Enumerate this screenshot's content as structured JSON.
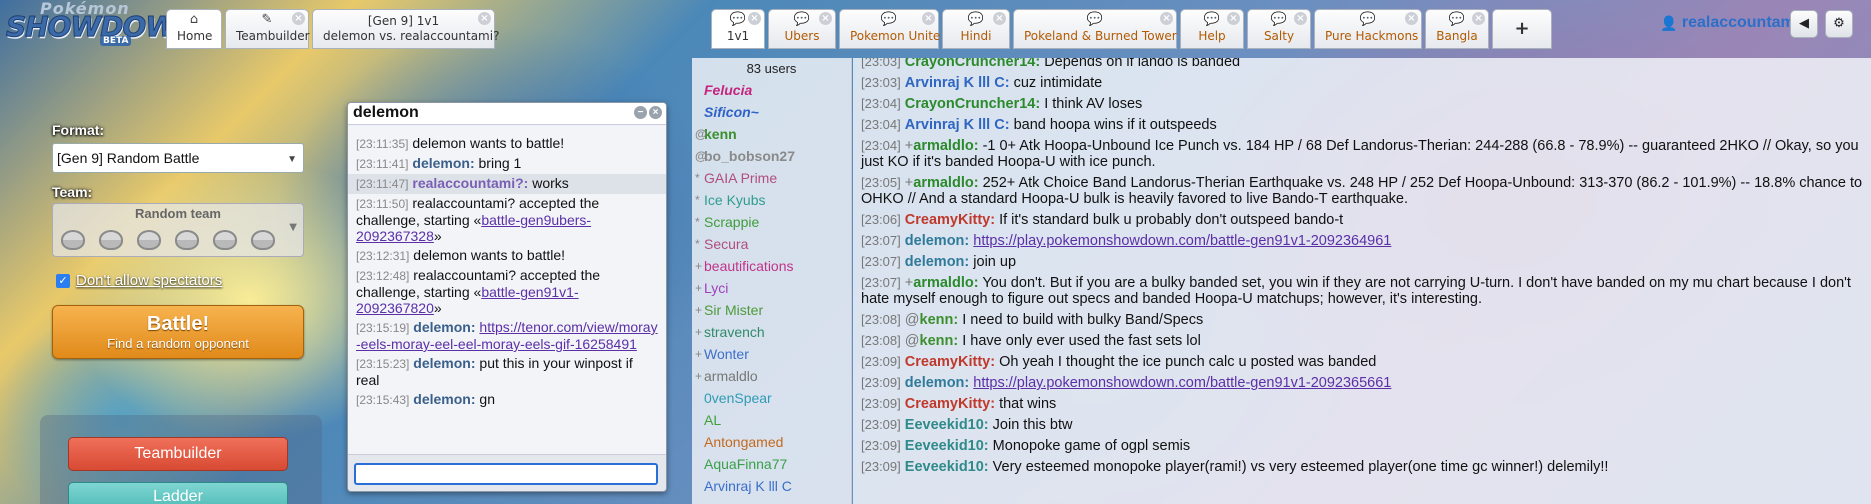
{
  "logo": {
    "line1": "Pokémon",
    "line2": "SHOWDOWN",
    "badge": "BETA"
  },
  "tabs": {
    "home": {
      "icon": "home-icon",
      "label": "Home"
    },
    "teambuilder": {
      "icon": "pencil-icon",
      "label": "Teambuilder"
    },
    "battle": {
      "line1": "[Gen 9] 1v1",
      "line2": "delemon vs. realaccountami?"
    },
    "rooms": [
      {
        "label": "1v1",
        "active": true
      },
      {
        "label": "Ubers"
      },
      {
        "label": "Pokemon Unite"
      },
      {
        "label": "Hindi"
      },
      {
        "label": "Pokeland & Burned Tower"
      },
      {
        "label": "Help"
      },
      {
        "label": "Salty"
      },
      {
        "label": "Pure Hackmons"
      },
      {
        "label": "Bangla"
      }
    ],
    "add_label": "+"
  },
  "user": {
    "name": "realaccountami?"
  },
  "left": {
    "format_label": "Format:",
    "format_value": "[Gen 9] Random Battle",
    "team_label": "Team:",
    "team_value": "Random team",
    "spectators_label": "Don't allow spectators",
    "battle_main": "Battle!",
    "battle_sub": "Find a random opponent",
    "teambuilder_btn": "Teambuilder",
    "ladder_btn": "Ladder"
  },
  "pm": {
    "title": "delemon",
    "lines": [
      {
        "ts": "[23:11:35]",
        "text": "delemon wants to battle!"
      },
      {
        "ts": "[23:11:41]",
        "name": "delemon:",
        "text": "bring 1"
      },
      {
        "ts": "[23:11:47]",
        "name": "realaccountami?:",
        "text": "works",
        "me": true
      },
      {
        "ts": "[23:11:50]",
        "text": "realaccountami? accepted the challenge, starting «",
        "link": "battle-gen9ubers-2092367328",
        "after": "»"
      },
      {
        "ts": "[23:12:31]",
        "text": "delemon wants to battle!"
      },
      {
        "ts": "[23:12:48]",
        "text": "realaccountami? accepted the challenge, starting «",
        "link": "battle-gen91v1-2092367820",
        "after": "»"
      },
      {
        "ts": "[23:15:19]",
        "name": "delemon:",
        "text": "",
        "link": "https://tenor.com/view/moray-eels-moray-eel-eel-moray-eels-gif-16258491",
        "after": ""
      },
      {
        "ts": "[23:15:23]",
        "name": "delemon:",
        "text": "put this in your winpost if real"
      },
      {
        "ts": "[23:15:43]",
        "name": "delemon:",
        "text": "gn"
      }
    ]
  },
  "userlist": {
    "count": "83 users",
    "users": [
      {
        "rank": "",
        "name": "Felucia",
        "color": "#c4257e",
        "bold": true,
        "italic": true
      },
      {
        "rank": "",
        "name": "Sificon~",
        "color": "#2f62c7",
        "bold": true,
        "italic": true
      },
      {
        "rank": "@",
        "name": "kenn",
        "color": "#3b8f2c",
        "bold": true
      },
      {
        "rank": "@",
        "name": "bo_bobson27",
        "color": "#8a8a8a",
        "bold": true
      },
      {
        "rank": "*",
        "name": "GAIA Prime",
        "color": "#b04f7c"
      },
      {
        "rank": "*",
        "name": "Ice Kyubs",
        "color": "#2f9c8e"
      },
      {
        "rank": "*",
        "name": "Scrappie",
        "color": "#3f9d3a"
      },
      {
        "rank": "*",
        "name": "Secura",
        "color": "#b04f7c"
      },
      {
        "rank": "+",
        "name": "beautifications",
        "color": "#c2338a"
      },
      {
        "rank": "+",
        "name": "Lyci",
        "color": "#a13fbf"
      },
      {
        "rank": "+",
        "name": "Sir Mister",
        "color": "#4e9a38"
      },
      {
        "rank": "+",
        "name": "stravench",
        "color": "#2f8a6a"
      },
      {
        "rank": "+",
        "name": "Wonter",
        "color": "#3f6ec9"
      },
      {
        "rank": "+",
        "name": "armaldlo",
        "color": "#777777"
      },
      {
        "rank": "",
        "name": "0venSpear",
        "color": "#2f9bb5"
      },
      {
        "rank": "",
        "name": "AL",
        "color": "#3fa03a"
      },
      {
        "rank": "",
        "name": "Antongamed",
        "color": "#c46a1e"
      },
      {
        "rank": "",
        "name": "AquaFinna77",
        "color": "#3aa04a"
      },
      {
        "rank": "",
        "name": "Arvinraj K lll C",
        "color": "#3a6fc9"
      }
    ]
  },
  "chat": [
    {
      "ts": "[23:03]",
      "name": "CrayonCruncher14:",
      "color": "#2b8a2b",
      "text": "Depends on if lando is banded"
    },
    {
      "ts": "[23:03]",
      "name": "Arvinraj K lll C:",
      "color": "#2f66c2",
      "text": "cuz intimidate"
    },
    {
      "ts": "[23:04]",
      "name": "CrayonCruncher14:",
      "color": "#2b8a2b",
      "text": "I think AV loses"
    },
    {
      "ts": "[23:04]",
      "name": "Arvinraj K lll C:",
      "color": "#2f66c2",
      "text": "band hoopa wins if it outspeeds"
    },
    {
      "ts": "[23:04]",
      "rank": "+",
      "name": "armaldlo:",
      "color": "#2b8a2b",
      "text": "-1 0+ Atk Hoopa-Unbound Ice Punch vs. 184 HP / 68 Def Landorus-Therian: 244-288 (66.8 - 78.9%) -- guaranteed 2HKO // Okay, so you just KO if it's banded Hoopa-U with ice punch."
    },
    {
      "ts": "[23:05]",
      "rank": "+",
      "name": "armaldlo:",
      "color": "#2b8a2b",
      "text": "252+ Atk Choice Band Landorus-Therian Earthquake vs. 248 HP / 252 Def Hoopa-Unbound: 313-370 (86.2 - 101.9%) -- 18.8% chance to OHKO // And a standard Hoopa-U bulk is heavily favored to live Bando-T earthquake."
    },
    {
      "ts": "[23:06]",
      "name": "CreamyKitty:",
      "color": "#c0392b",
      "text": "If it's standard bulk u probably don't outspeed bando-t"
    },
    {
      "ts": "[23:07]",
      "name": "delemon:",
      "color": "#2f7a9a",
      "text": "",
      "link": "https://play.pokemonshowdown.com/battle-gen91v1-2092364961"
    },
    {
      "ts": "[23:07]",
      "name": "delemon:",
      "color": "#2f7a9a",
      "text": "join up"
    },
    {
      "ts": "[23:07]",
      "rank": "+",
      "name": "armaldlo:",
      "color": "#2b8a2b",
      "text": "You don't. But if you are a bulky banded set, you win if they are not carrying U-turn. I don't have banded on my mu chart because I don't hate myself enough to figure out specs and banded Hoopa-U matchups; however, it's interesting."
    },
    {
      "ts": "[23:08]",
      "rank": "@",
      "name": "kenn:",
      "color": "#3b8f2c",
      "text": "I need to build with bulky Band/Specs"
    },
    {
      "ts": "[23:08]",
      "rank": "@",
      "name": "kenn:",
      "color": "#3b8f2c",
      "text": "I have only ever used the fast sets lol"
    },
    {
      "ts": "[23:09]",
      "name": "CreamyKitty:",
      "color": "#c0392b",
      "text": "Oh yeah I thought the ice punch calc u posted was banded"
    },
    {
      "ts": "[23:09]",
      "name": "delemon:",
      "color": "#2f7a9a",
      "text": "",
      "link": "https://play.pokemonshowdown.com/battle-gen91v1-2092365661"
    },
    {
      "ts": "[23:09]",
      "name": "CreamyKitty:",
      "color": "#c0392b",
      "text": "that wins"
    },
    {
      "ts": "[23:09]",
      "name": "Eeveekid10:",
      "color": "#2f8a8a",
      "text": "Join this btw"
    },
    {
      "ts": "[23:09]",
      "name": "Eeveekid10:",
      "color": "#2f8a8a",
      "text": "Monopoke game of ogpl semis"
    },
    {
      "ts": "[23:09]",
      "name": "Eeveekid10:",
      "color": "#2f8a8a",
      "text": "Very esteemed monopoke player(rami!) vs very esteemed player(one time gc winner!) delemily!!"
    }
  ]
}
